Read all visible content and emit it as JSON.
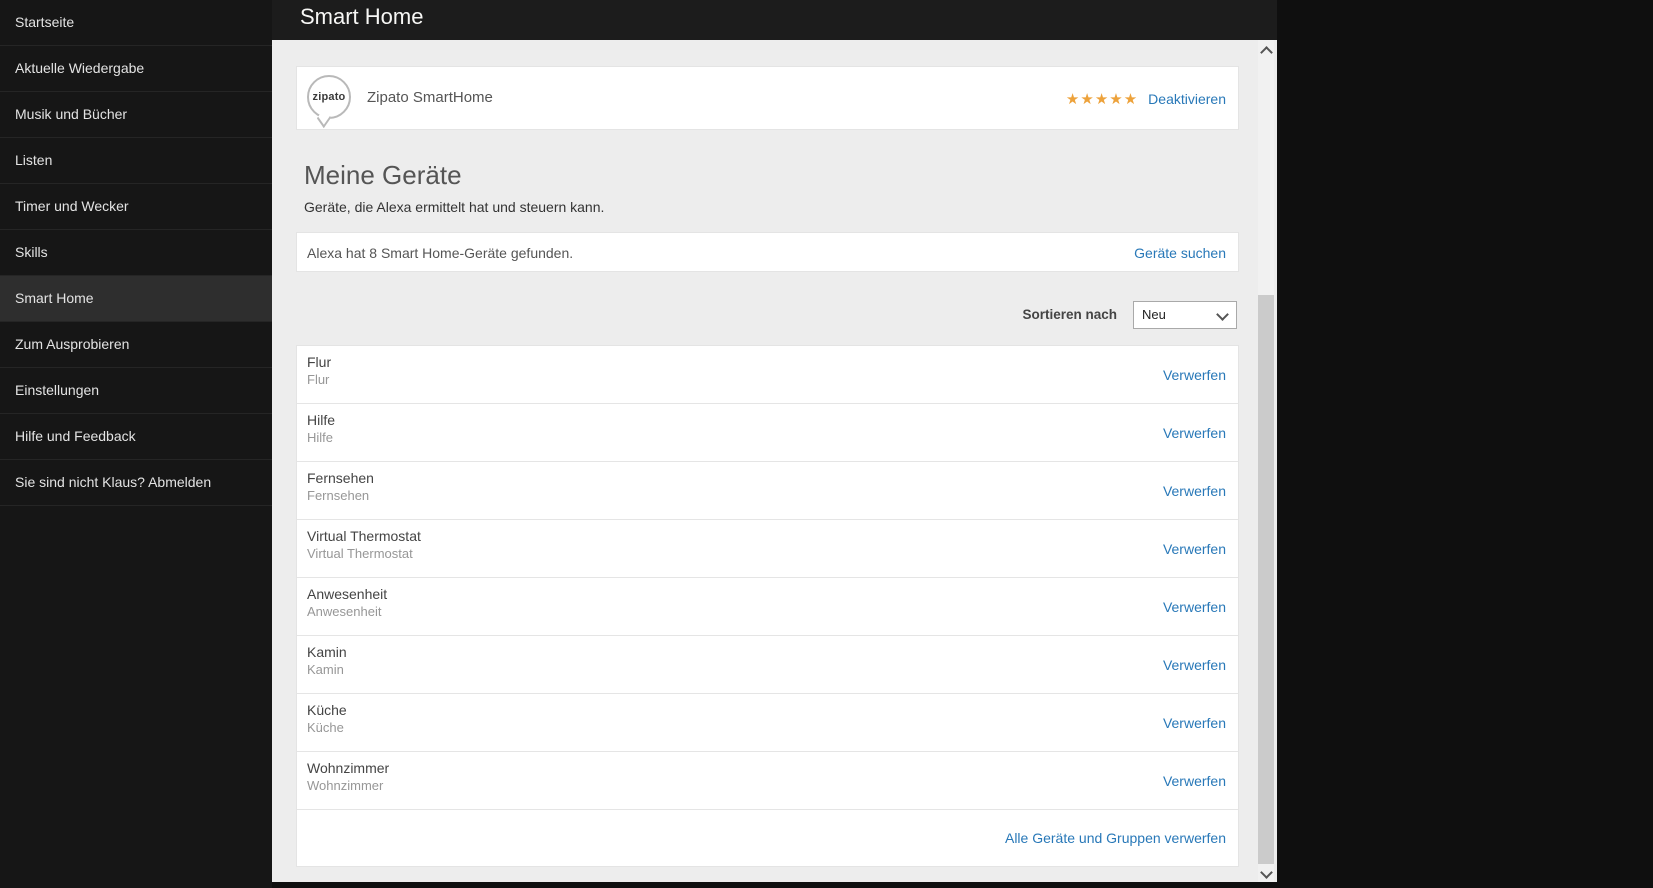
{
  "header": {
    "title": "Smart Home"
  },
  "sidebar": {
    "items": [
      {
        "label": "Startseite"
      },
      {
        "label": "Aktuelle Wiedergabe"
      },
      {
        "label": "Musik und Bücher"
      },
      {
        "label": "Listen"
      },
      {
        "label": "Timer und Wecker"
      },
      {
        "label": "Skills"
      },
      {
        "label": "Smart Home",
        "selected": true
      },
      {
        "label": "Zum Ausprobieren"
      },
      {
        "label": "Einstellungen"
      },
      {
        "label": "Hilfe und Feedback"
      },
      {
        "label": "Sie sind nicht Klaus? Abmelden"
      }
    ]
  },
  "skill": {
    "logo_text": "zipato",
    "name": "Zipato SmartHome",
    "stars": "★★★★★",
    "deactivate_label": "Deaktivieren"
  },
  "devices": {
    "section_title": "Meine Geräte",
    "section_subtitle": "Geräte, die Alexa ermittelt hat und steuern kann.",
    "found_text": "Alexa hat 8 Smart Home-Geräte gefunden.",
    "search_link": "Geräte suchen",
    "sort_label": "Sortieren nach",
    "sort_value": "Neu",
    "dismiss_label": "Verwerfen",
    "dismiss_all_label": "Alle Geräte und Gruppen verwerfen",
    "list": [
      {
        "name": "Flur",
        "description": "Flur"
      },
      {
        "name": "Hilfe",
        "description": "Hilfe"
      },
      {
        "name": "Fernsehen",
        "description": "Fernsehen"
      },
      {
        "name": "Virtual Thermostat",
        "description": "Virtual Thermostat"
      },
      {
        "name": "Anwesenheit",
        "description": "Anwesenheit"
      },
      {
        "name": "Kamin",
        "description": "Kamin"
      },
      {
        "name": "Küche",
        "description": "Küche"
      },
      {
        "name": "Wohnzimmer",
        "description": "Wohnzimmer"
      }
    ]
  },
  "colors": {
    "link_blue": "#2878b8",
    "star_orange": "#eda23b",
    "sidebar_selected": "#2e2e2e"
  }
}
